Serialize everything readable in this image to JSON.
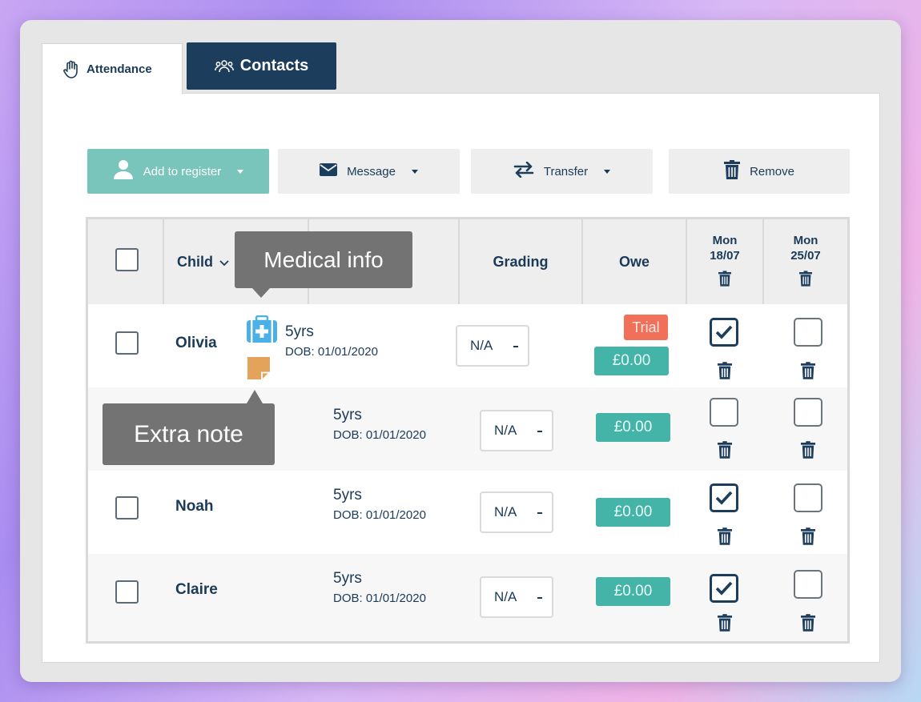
{
  "tabs": {
    "attendance": "Attendance",
    "contacts": "Contacts"
  },
  "toolbar": {
    "add_label": "Add to register",
    "message_label": "Message",
    "transfer_label": "Transfer",
    "remove_label": "Remove"
  },
  "table": {
    "headers": {
      "child": "Child",
      "grading": "Grading",
      "owe": "Owe",
      "date1_day": "Mon",
      "date1_date": "18/07",
      "date2_day": "Mon",
      "date2_date": "25/07"
    },
    "rows": [
      {
        "name": "Olivia",
        "age": "5yrs",
        "dob": "DOB: 01/01/2020",
        "grading": "N/A",
        "owe": "£0.00",
        "badge": "Trial",
        "date1_checked": true,
        "date2_checked": false
      },
      {
        "name": "",
        "age": "5yrs",
        "dob": "DOB: 01/01/2020",
        "grading": "N/A",
        "owe": "£0.00",
        "date1_checked": false,
        "date2_checked": false
      },
      {
        "name": "Noah",
        "age": "5yrs",
        "dob": "DOB: 01/01/2020",
        "grading": "N/A",
        "owe": "£0.00",
        "date1_checked": true,
        "date2_checked": false
      },
      {
        "name": "Claire",
        "age": "5yrs",
        "dob": "DOB: 01/01/2020",
        "grading": "N/A",
        "owe": "£0.00",
        "date1_checked": true,
        "date2_checked": false
      }
    ]
  },
  "tooltips": {
    "medical": "Medical info",
    "note": "Extra note"
  },
  "colors": {
    "navy": "#1d3d5c",
    "teal": "#44b3a8",
    "add_button": "#79c4bb",
    "trial": "#f0705a",
    "medical_icon": "#4ab0e6",
    "note_icon": "#e4a35a"
  }
}
